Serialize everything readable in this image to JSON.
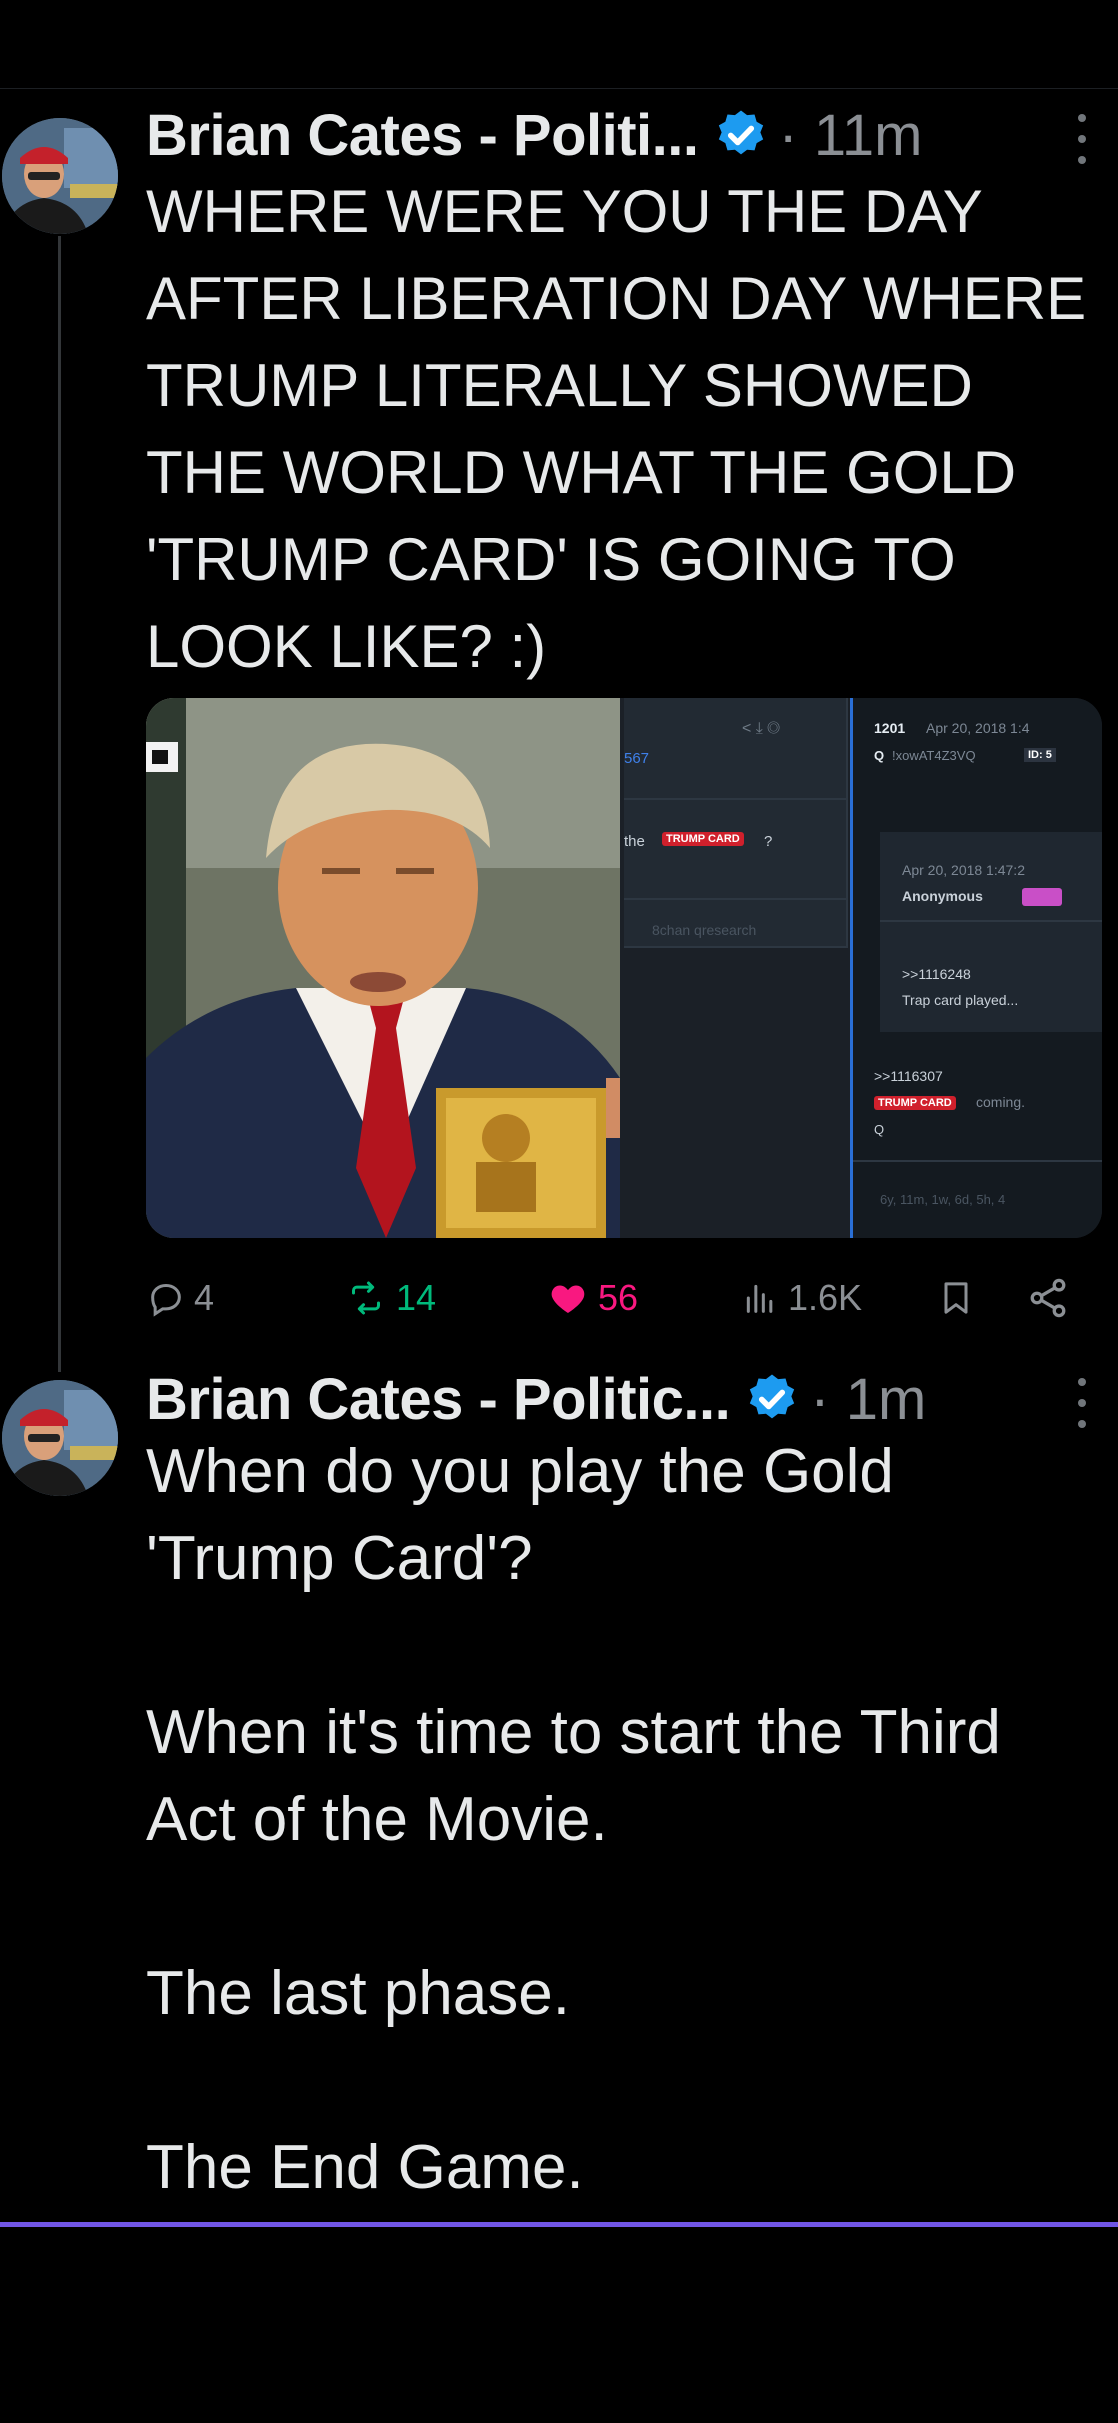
{
  "posts": [
    {
      "author": "Brian Cates - Politi...",
      "time": "· 11m",
      "lines": [
        "WHERE WERE YOU THE DAY",
        "AFTER LIBERATION DAY WHERE",
        "TRUMP LITERALLY SHOWED",
        "THE WORLD WHAT THE GOLD",
        "'TRUMP CARD' IS GOING TO",
        "LOOK LIKE? :)"
      ],
      "stats": {
        "replies": "4",
        "reposts": "14",
        "likes": "56",
        "views": "1.6K"
      }
    },
    {
      "author": "Brian Cates - Politic...",
      "time": "· 1m",
      "lines": [
        "When do you play the Gold",
        "'Trump Card'?",
        "",
        "When it's time to start the Third",
        "Act of the Movie.",
        "",
        "The last phase.",
        "",
        "The End Game."
      ]
    }
  ],
  "media": {
    "board_post_ref": "567",
    "board_snippet": "the",
    "trump_card_tag": "TRUMP CARD",
    "trump_card_suffix": "?",
    "board_name": "8chan qresearch",
    "post_number": "1201",
    "post_date": "Apr 20, 2018 1:4",
    "q_label": "Q",
    "trip_code": "!xowAT4Z3VQ",
    "id_tag": "ID: 5",
    "reply_date": "Apr 20, 2018 1:47:2",
    "reply_author": "Anonymous",
    "reply_ref1": ">>1116248",
    "reply_text1": "Trap card played...",
    "reply_ref2": ">>1116307",
    "reply_text2": "coming.",
    "reply_sign": "Q",
    "age_text": "6y, 11m, 1w, 6d, 5h, 4"
  },
  "colors": {
    "verified": "#1d9bf0",
    "like": "#f91880",
    "repost": "#00ba7c",
    "accent_bar": "#7156e6"
  }
}
